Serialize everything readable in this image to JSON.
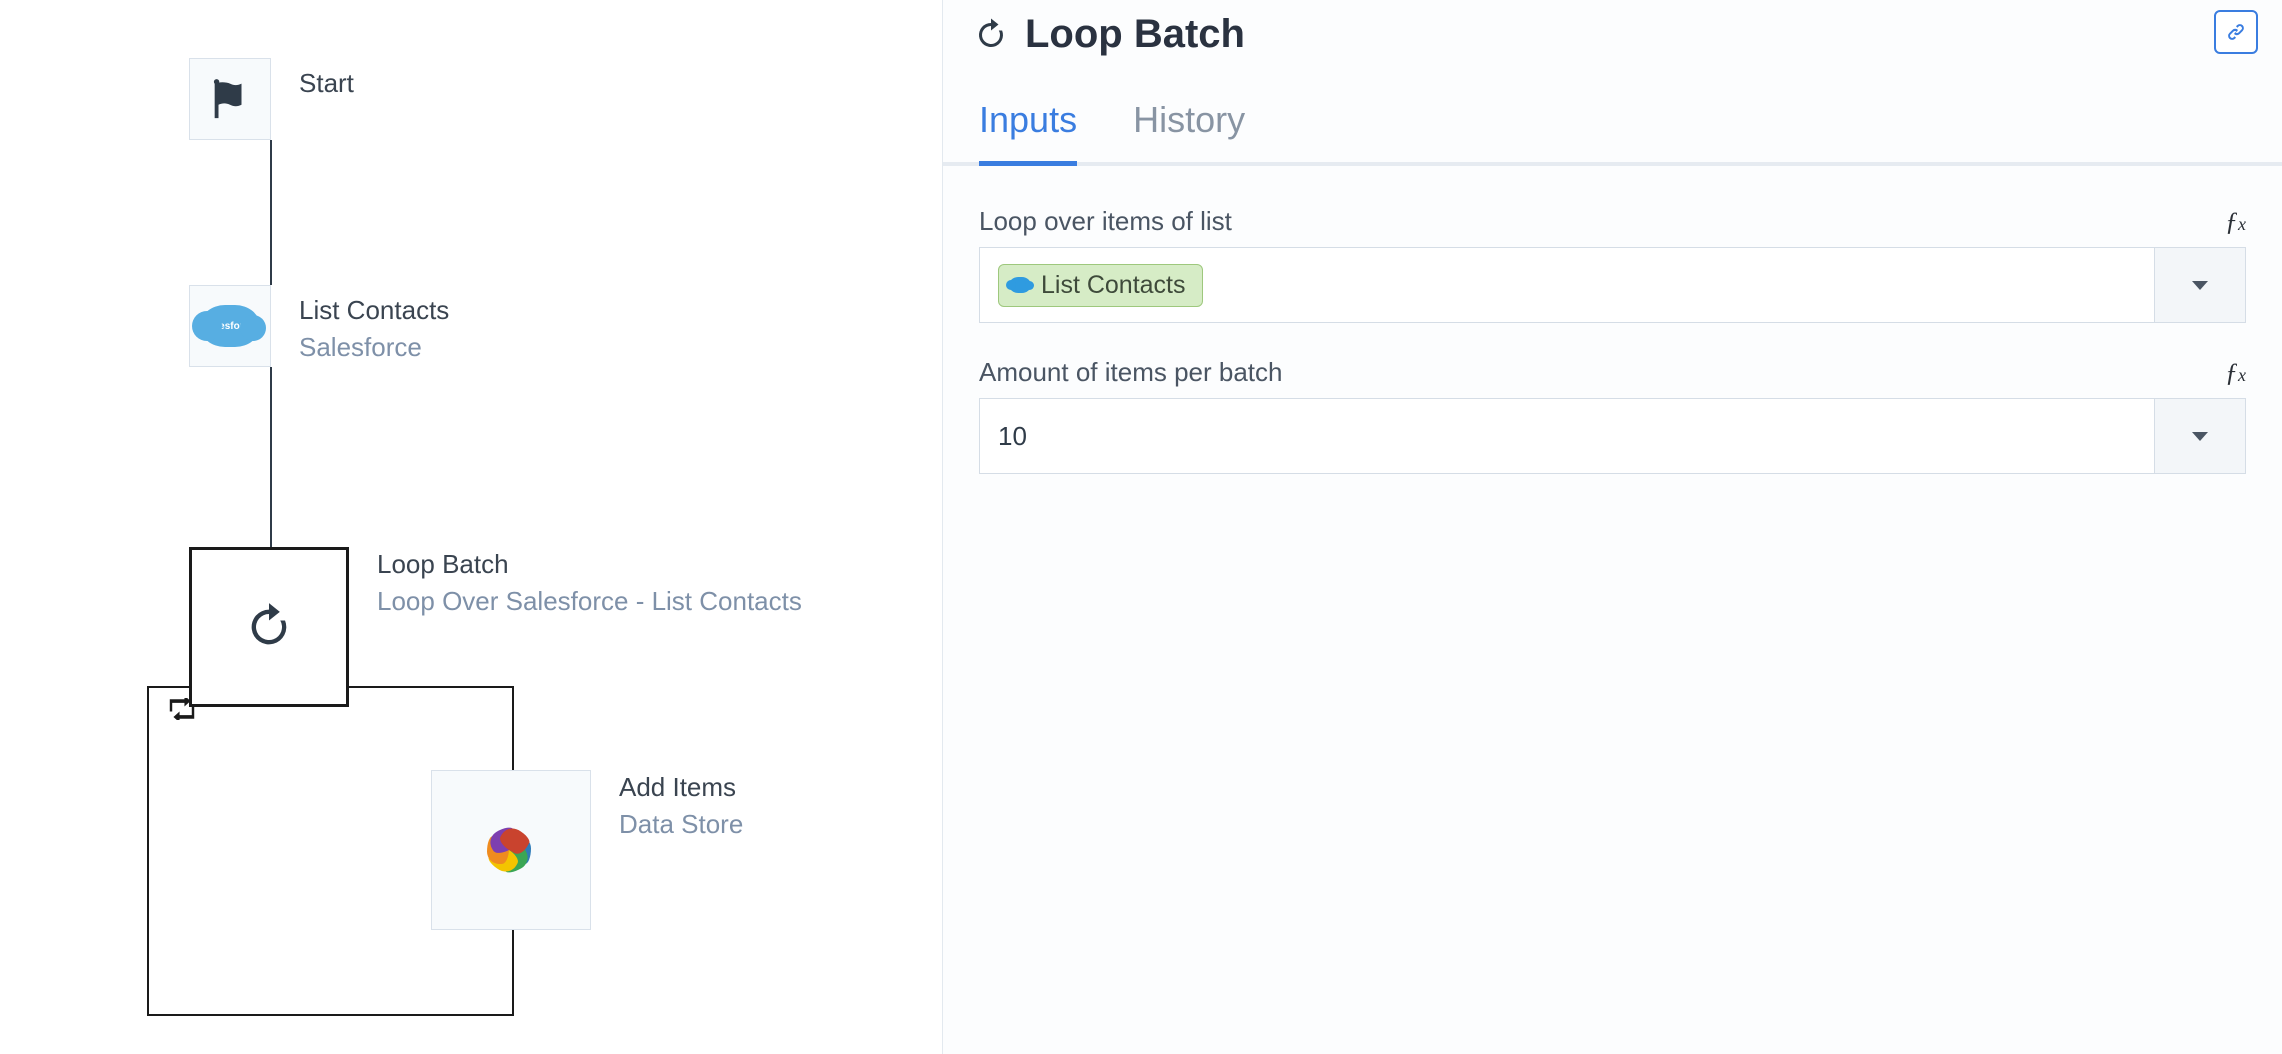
{
  "canvas": {
    "nodes": {
      "start": {
        "title": "Start"
      },
      "listContacts": {
        "title": "List Contacts",
        "subtitle": "Salesforce"
      },
      "loopBatch": {
        "title": "Loop Batch",
        "subtitle": "Loop Over Salesforce - List Contacts"
      },
      "addItems": {
        "title": "Add Items",
        "subtitle": "Data Store"
      }
    }
  },
  "panel": {
    "title": "Loop Batch",
    "tabs": {
      "inputs": "Inputs",
      "history": "History"
    },
    "fields": {
      "loopList": {
        "label": "Loop over items of list",
        "chip": "List Contacts"
      },
      "batchSize": {
        "label": "Amount of items per batch",
        "value": "10"
      }
    }
  }
}
